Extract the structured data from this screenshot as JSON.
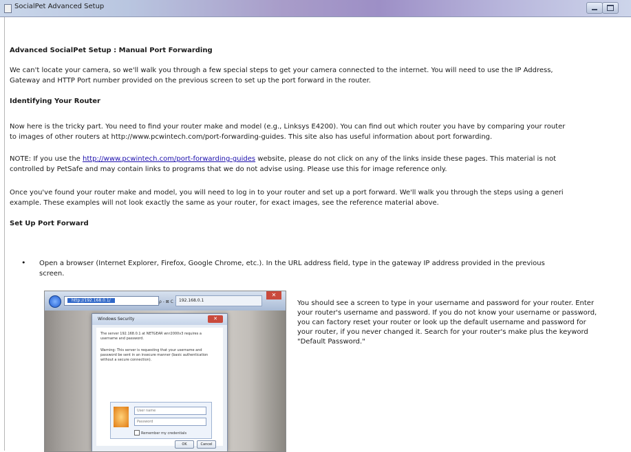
{
  "window": {
    "title": "SocialPet Advanced Setup"
  },
  "page": {
    "heading": "Advanced SocialPet Setup : Manual Port Forwarding",
    "intro": [
      "We can't locate your camera, so we'll walk you through a few special steps to get your camera connected to the internet. You will need to use the IP Address,",
      "Gateway  and HTTP Port number provided on the previous screen to set up the port forward in the router."
    ],
    "section1_heading": "Identifying Your Router",
    "section1_text": [
      "Now here is the tricky part. You need to find your router make and model (e.g., Linksys E4200). You can find out which router you have by comparing your router",
      "to images of other routers at  http://www.pcwintech.com/port-forwarding-guides. This site also has useful information about port forwarding."
    ],
    "note": {
      "prefix": "NOTE: If you use the ",
      "link": "http://www.pcwintech.com/port-forwarding-guides",
      "suffix": " website, please do not click on any of the links inside these pages. This material is not",
      "line2": "controlled by PetSafe and may contain links to programs that we do not advise using. Please use this for image reference only."
    },
    "once_text": [
      "Once you've found your router make and model, you will need to log in to your router and set up a port forward. We'll walk you through the steps using a generi",
      "example. These examples will not look exactly the same as your router, for exact images, see the reference material above."
    ],
    "section2_heading": "Set Up Port Forward",
    "bullet": {
      "symbol": "•",
      "lines": [
        "Open a browser (Internet Explorer, Firefox, Google Chrome, etc.). In the URL address field, type in the gateway IP address provided in the previous",
        "screen."
      ]
    },
    "side_text": [
      " You should see a screen to type in your username and password for your router. Enter",
      "your router's username and password. If you do not know your username or password,",
      "you can factory reset your router or look up the default username and password for",
      "your router, if you never changed it. Search for your router's make plus the keyword",
      "\"Default Password.\""
    ]
  },
  "screenshot": {
    "address": "http://192.168.0.1/",
    "controls": "ρ - ⊠ C ×",
    "tab": "192.168.0.1",
    "dialog_title": "Windows Security",
    "dialog_text_1": "The server 192.168.0.1 at NETGEAR wnr2000v3 requires a username and password.",
    "dialog_text_2": "Warning: This server is requesting that your username and password be sent in an insecure manner (basic authentication without a secure connection).",
    "user_placeholder": "User name",
    "pass_placeholder": "Password",
    "remember_label": "Remember my credentials",
    "ok_label": "OK",
    "cancel_label": "Cancel"
  }
}
